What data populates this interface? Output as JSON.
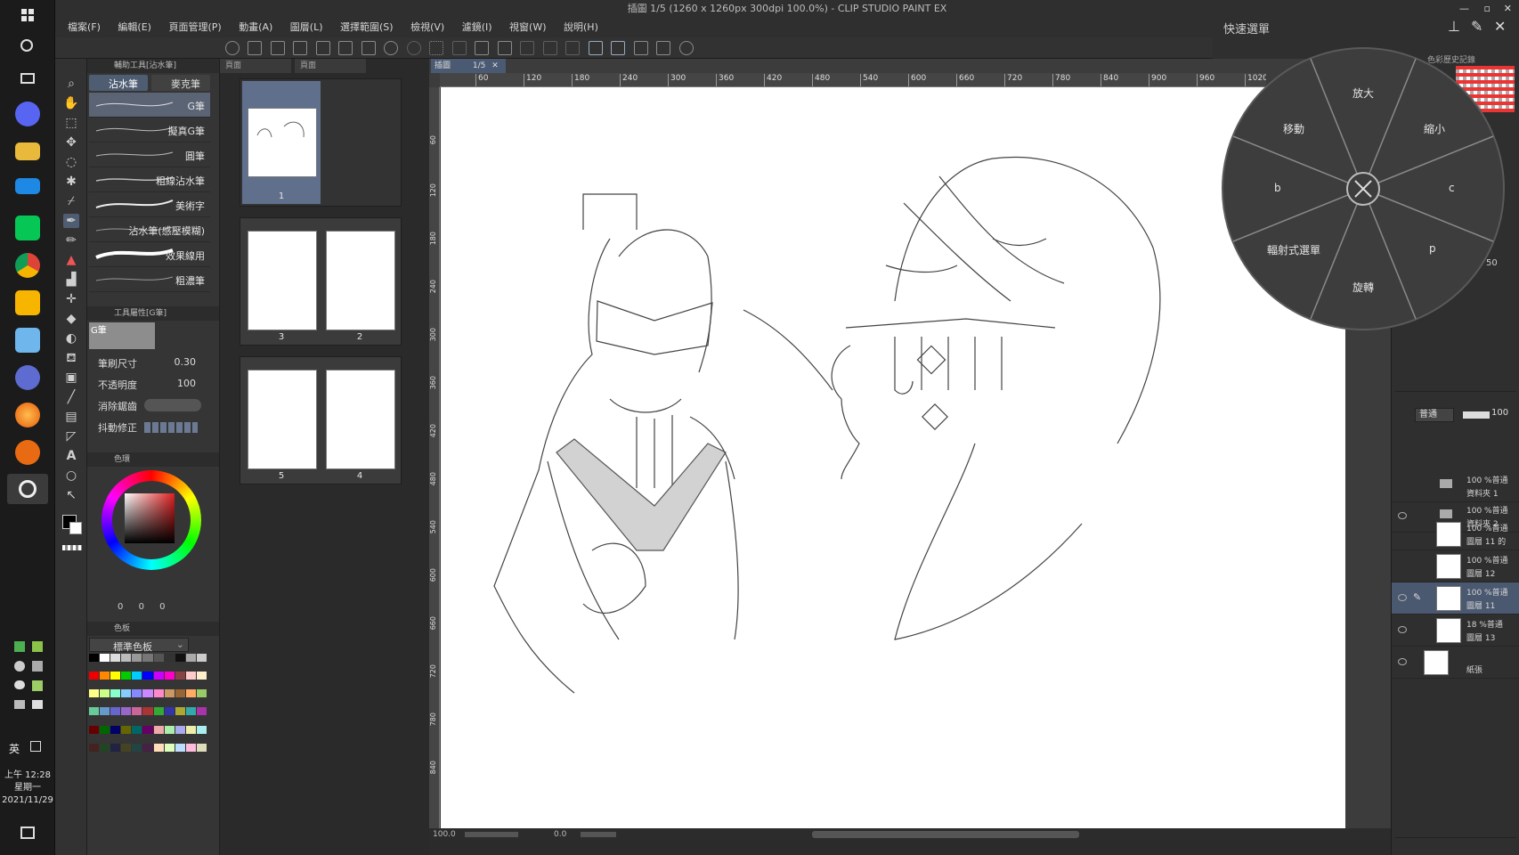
{
  "window": {
    "title": "插圖 1/5 (1260 x 1260px 300dpi 100.0%) - CLIP STUDIO PAINT EX"
  },
  "menu": [
    "檔案(F)",
    "編輯(E)",
    "頁面管理(P)",
    "動畫(A)",
    "圖層(L)",
    "選擇範圍(S)",
    "檢視(V)",
    "濾鏡(I)",
    "視窗(W)",
    "說明(H)"
  ],
  "quick_access": {
    "label": "快速選單"
  },
  "sub_tool": {
    "header": "輔助工具[沾水筆]",
    "tabs": [
      "沾水筆",
      "麥克筆"
    ],
    "brushes": [
      "G筆",
      "擬真G筆",
      "圓筆",
      "粗線沾水筆",
      "美術字",
      "沾水筆(感壓模糊)",
      "效果線用",
      "粗濃筆"
    ]
  },
  "tool_property": {
    "header": "工具屬性[G筆]",
    "preview_label": "G筆",
    "brush_size": {
      "label": "筆刷尺寸",
      "value": "0.30"
    },
    "opacity": {
      "label": "不透明度",
      "value": "100"
    },
    "antialias": {
      "label": "消除鋸齒"
    },
    "stabilization": {
      "label": "抖動修正"
    }
  },
  "color_wheel": {
    "header": "色環",
    "fg_color": "#000000",
    "bg_color": "#ffffff",
    "values": [
      "0",
      "0",
      "0"
    ]
  },
  "color_set": {
    "header": "色板",
    "name": "標準色板"
  },
  "page_panel": {
    "tabs": [
      "頁面",
      "頁面"
    ],
    "pages": [
      "1",
      "3",
      "2",
      "5",
      "4"
    ]
  },
  "canvas": {
    "tab_label": "插圖",
    "tab_page": "1/5",
    "ruler_ticks": [
      "60",
      "120",
      "180",
      "240",
      "300",
      "360",
      "420",
      "480",
      "540",
      "600",
      "660",
      "720",
      "780",
      "840",
      "900",
      "960",
      "1020"
    ],
    "left_ticks": [
      "60",
      "120",
      "180",
      "240",
      "300",
      "360",
      "420",
      "480",
      "540",
      "600",
      "660",
      "720",
      "780",
      "840"
    ],
    "zoom": "100.0",
    "angle": "0.0"
  },
  "radial_menu": {
    "items": [
      "放大",
      "縮小",
      "c",
      "p",
      "旋轉",
      "輻射式選單",
      "b",
      "移動"
    ]
  },
  "layers": {
    "blend_mode": "普通",
    "opacity": "100",
    "zoom_value": "50",
    "history_label": "色彩歷史記錄",
    "rows": [
      {
        "line1": "100 %普通",
        "line2": "資料夾 1"
      },
      {
        "line1": "100 %普通",
        "line2": "資料夾 2"
      },
      {
        "line1": "100 %普通",
        "line2": "圖層 11 的"
      },
      {
        "line1": "100 %普通",
        "line2": "圖層 12"
      },
      {
        "line1": "100 %普通",
        "line2": "圖層 11"
      },
      {
        "line1": "18 %普通",
        "line2": "圖層 13"
      },
      {
        "line1": "",
        "line2": "紙張"
      }
    ]
  },
  "taskbar": {
    "lang": "英",
    "time": "上午 12:28",
    "weekday": "星期一",
    "date": "2021/11/29"
  }
}
